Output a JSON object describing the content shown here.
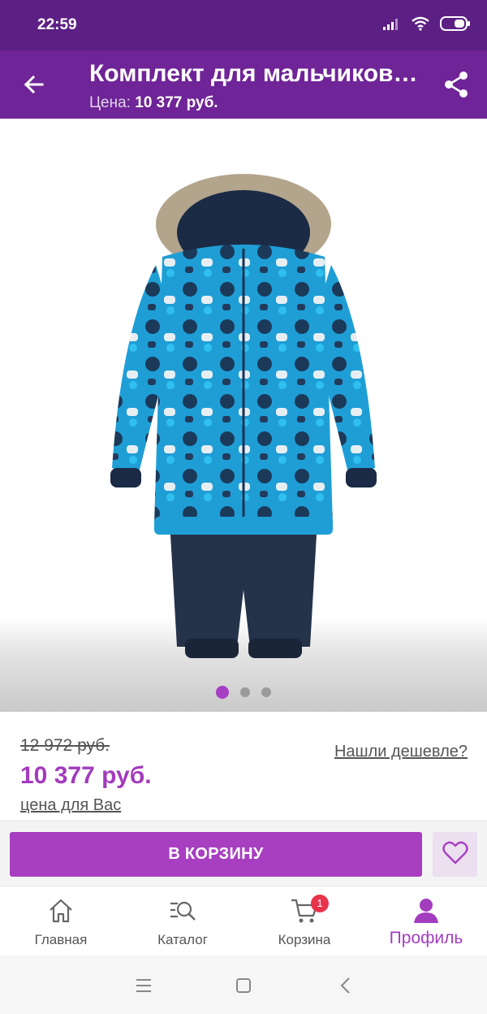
{
  "status": {
    "time": "22:59"
  },
  "header": {
    "title": "Комплект для мальчиков Lenne",
    "price_label": "Цена:",
    "price_value": "10 377 руб."
  },
  "gallery": {
    "slide_count": 3,
    "active_slide": 1
  },
  "pricing": {
    "old_price": "12 972 руб.",
    "new_price": "10 377 руб.",
    "note": "цена для Вас",
    "cheaper_link": "Нашли дешевле?"
  },
  "actions": {
    "cart_button": "В КОРЗИНУ"
  },
  "bottom_nav": {
    "items": [
      {
        "label": "Главная",
        "icon": "home-icon"
      },
      {
        "label": "Каталог",
        "icon": "catalog-search-icon"
      },
      {
        "label": "Корзина",
        "icon": "cart-icon",
        "badge": "1"
      },
      {
        "label": "Профиль",
        "icon": "profile-icon",
        "active": true
      }
    ]
  },
  "colors": {
    "status_bar": "#5c1f84",
    "app_bar": "#6f2497",
    "accent": "#a73fc0",
    "badge": "#e8334a"
  }
}
